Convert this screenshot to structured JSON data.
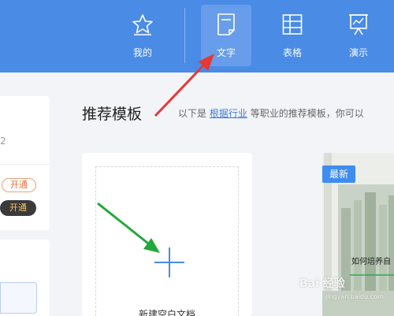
{
  "nav": {
    "items": [
      {
        "label": "我的",
        "icon": "star-icon"
      },
      {
        "label": "文字",
        "icon": "document-icon",
        "active": true
      },
      {
        "label": "表格",
        "icon": "table-icon"
      },
      {
        "label": "演示",
        "icon": "presentation-icon"
      }
    ]
  },
  "sidebar": {
    "number": "2",
    "badge_outline": "开通",
    "badge_dark": "开通"
  },
  "main": {
    "title": "推荐模板",
    "desc_prefix": "以下是",
    "desc_link": "根据行业",
    "desc_suffix": "等职业的推荐模板，你可以",
    "blank_doc_label": "新建空白文档",
    "new_badge": "最新",
    "template_text": "如何培养自"
  },
  "watermark": {
    "text": "Bai 经验",
    "sub": "jingyan.baidu.com"
  },
  "colors": {
    "topbar": "#4a8be6",
    "accent": "#3b7ad9",
    "new_badge": "#3e8df0",
    "red_arrow": "#e53935",
    "green_arrow": "#22a83a"
  }
}
